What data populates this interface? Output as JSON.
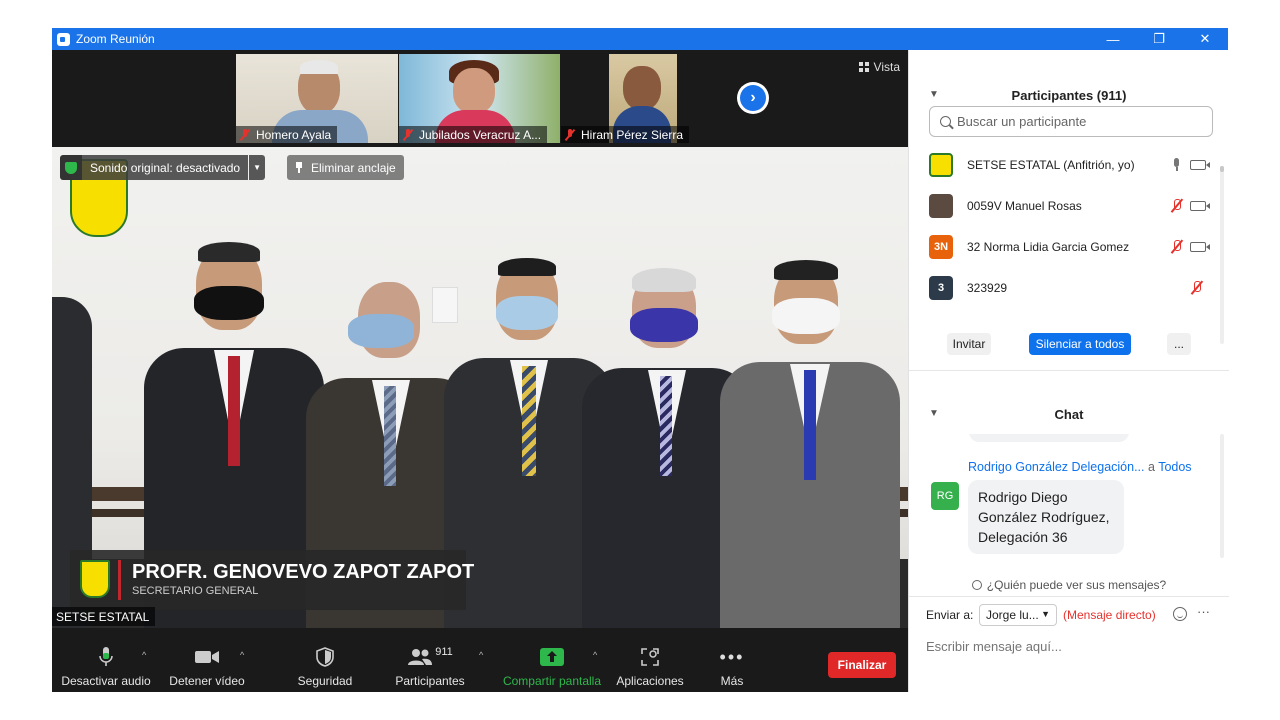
{
  "window": {
    "title": "Zoom Reunión"
  },
  "thumbnails": [
    {
      "name": "Homero Ayala"
    },
    {
      "name": "Jubilados Veracruz A..."
    },
    {
      "name": "Hiram Pérez Sierra"
    }
  ],
  "view_button": "Vista",
  "main_video": {
    "original_sound": "Sonido original: desactivado",
    "unpin": "Eliminar anclaje",
    "lower_third_name": "PROFR. GENOVEVO ZAPOT ZAPOT",
    "lower_third_role": "SECRETARIO GENERAL",
    "speaker": "SETSE ESTATAL"
  },
  "toolbar": {
    "mute": "Desactivar audio",
    "video": "Detener vídeo",
    "security": "Seguridad",
    "participants": "Participantes",
    "participants_count": "911",
    "share": "Compartir pantalla",
    "apps": "Aplicaciones",
    "more": "Más",
    "end": "Finalizar"
  },
  "participants_panel": {
    "title": "Participantes (911)",
    "search_placeholder": "Buscar un participante",
    "list": [
      {
        "name": "SETSE ESTATAL (Anfitrión, yo)",
        "avatar": "",
        "avatar_color": "#f7e000"
      },
      {
        "name": "0059V Manuel Rosas",
        "avatar": "",
        "avatar_color": "#5a4a40"
      },
      {
        "name": "32 Norma Lidia Garcia Gomez",
        "avatar": "3N",
        "avatar_color": "#e8620c"
      },
      {
        "name": "323929",
        "avatar": "3",
        "avatar_color": "#2d3a4a"
      }
    ],
    "invite": "Invitar",
    "mute_all": "Silenciar a todos",
    "more": "..."
  },
  "chat_panel": {
    "title": "Chat",
    "message": {
      "from": "Rodrigo González Delegación...",
      "to_word": "a",
      "to": "Todos",
      "avatar": "RG",
      "text": "Rodrigo Diego González Rodríguez, Delegación 36"
    },
    "who_sees": "¿Quién puede ver sus mensajes?",
    "send_to_label": "Enviar a:",
    "send_to_value": "Jorge lu...",
    "direct_note": "(Mensaje directo)",
    "more": "···",
    "input_placeholder": "Escribir mensaje aquí..."
  },
  "colors": {
    "accent": "#0e72ed",
    "titlebar": "#1a73e8",
    "end": "#e02828",
    "share": "#2eb84c"
  }
}
